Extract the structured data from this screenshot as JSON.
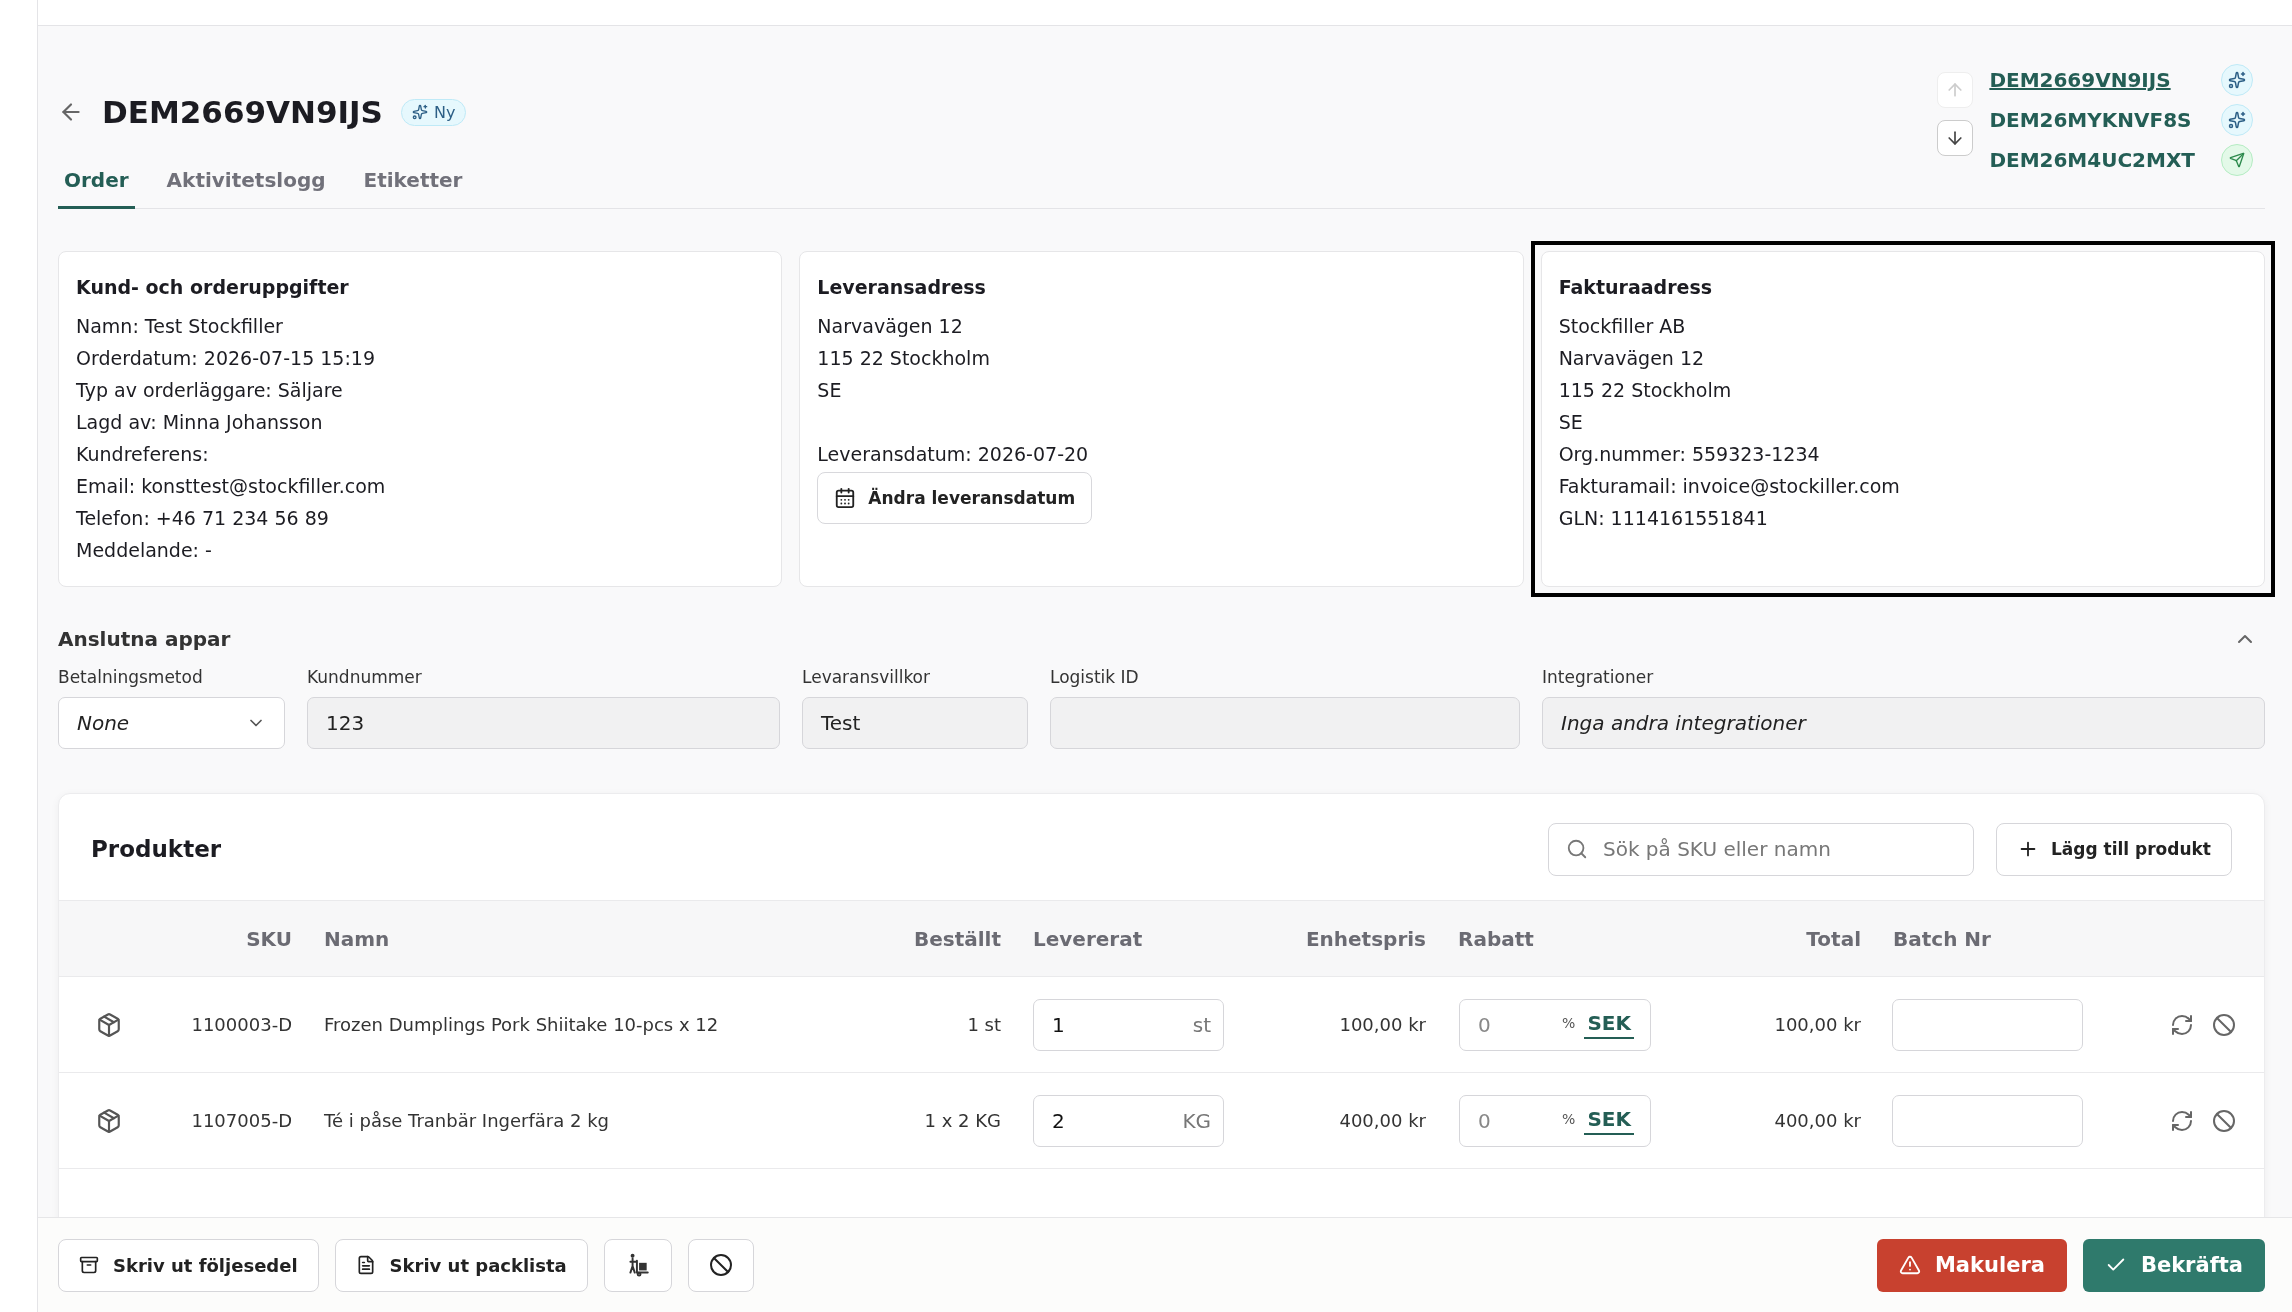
{
  "header": {
    "title": "DEM2669VN9IJS",
    "badge": "Ny"
  },
  "order_nav": {
    "up_disabled": true,
    "down_disabled": false,
    "items": [
      {
        "id": "DEM2669VN9IJS",
        "selected": true,
        "kind": "new"
      },
      {
        "id": "DEM26MYKNVF8S",
        "selected": false,
        "kind": "new"
      },
      {
        "id": "DEM26M4UC2MXT",
        "selected": false,
        "kind": "sent"
      }
    ]
  },
  "tabs": [
    {
      "label": "Order",
      "selected": true
    },
    {
      "label": "Aktivitetslogg",
      "selected": false
    },
    {
      "label": "Etiketter",
      "selected": false
    }
  ],
  "cards": [
    {
      "title": "Kund- och orderuppgifter",
      "highlighted": false,
      "lines": [
        "Namn: Test Stockfiller",
        "Orderdatum: 2026-07-15 15:19",
        "Typ av orderläggare: Säljare",
        "Lagd av: Minna Johansson",
        "Kundreferens:",
        "Email: konsttest@stockfiller.com",
        "Telefon: +46 71 234 56 89",
        "Meddelande: -"
      ]
    },
    {
      "title": "Leveransadress",
      "highlighted": false,
      "lines": [
        "Narvavägen 12",
        "115 22 Stockholm",
        "SE"
      ],
      "extra_lines": [
        "Leveransdatum: 2026-07-20"
      ],
      "button": "Ändra leveransdatum"
    },
    {
      "title": "Fakturaadress",
      "highlighted": true,
      "lines": [
        "Stockfiller AB",
        "Narvavägen 12",
        "115 22 Stockholm",
        "SE",
        "Org.nummer: 559323-1234",
        "Fakturamail: invoice@stockiller.com",
        "GLN: 1114161551841"
      ]
    }
  ],
  "connected_apps": {
    "title": "Anslutna appar",
    "expanded": true,
    "fields": [
      {
        "label": "Betalningsmetod",
        "kind": "select",
        "value": "None"
      },
      {
        "label": "Kundnummer",
        "kind": "readonly",
        "value": "123"
      },
      {
        "label": "Levaransvillkor",
        "kind": "readonly",
        "value": "Test"
      },
      {
        "label": "Logistik ID",
        "kind": "readonly"
      },
      {
        "label": "Integrationer",
        "kind": "info",
        "value": "Inga andra integrationer"
      }
    ]
  },
  "products": {
    "title": "Produkter",
    "search": {
      "placeholder": "Sök på SKU eller namn"
    },
    "add_button": "Lägg till produkt",
    "columns": [
      "SKU",
      "Namn",
      "Beställt",
      "Levererat",
      "Enhetspris",
      "Rabatt",
      "Total",
      "Batch Nr"
    ],
    "rows": [
      {
        "sku": "1100003-D",
        "name": "Frozen Dumplings Pork Shiitake 10-pcs x 12",
        "ordered": "1 st",
        "delivered": "1",
        "unit": "st",
        "price": "100,00 kr",
        "discount": "0",
        "discount_units": [
          {
            "label": "%",
            "selected": false
          },
          {
            "label": "SEK",
            "selected": true
          }
        ],
        "total": "100,00 kr"
      },
      {
        "sku": "1107005-D",
        "name": "Té i påse Tranbär Ingerfära 2 kg",
        "ordered": "1 x 2 KG",
        "delivered": "2",
        "unit": "KG",
        "price": "400,00 kr",
        "discount": "0",
        "discount_units": [
          {
            "label": "%",
            "selected": false
          },
          {
            "label": "SEK",
            "selected": true
          }
        ],
        "total": "400,00 kr"
      }
    ]
  },
  "footer": {
    "left_buttons": [
      {
        "label": "Skriv ut följesedel",
        "kind": "print"
      },
      {
        "label": "Skriv ut packlista",
        "kind": "file"
      },
      {
        "kind": "dolly"
      },
      {
        "kind": "ban"
      }
    ],
    "right_buttons": [
      {
        "label": "Makulera",
        "kind": "danger"
      },
      {
        "label": "Bekräfta",
        "kind": "confirm"
      }
    ]
  }
}
